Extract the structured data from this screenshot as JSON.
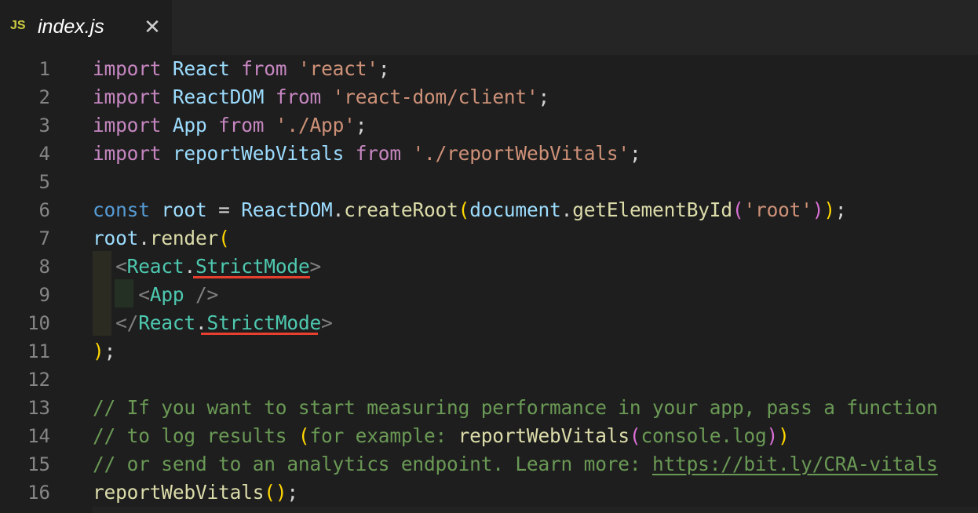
{
  "tab": {
    "icon_label": "JS",
    "title": "index.js",
    "close_glyph": "✕"
  },
  "lines": [
    {
      "n": "1",
      "tokens": [
        [
          "kw",
          "import"
        ],
        [
          "p",
          " "
        ],
        [
          "id",
          "React"
        ],
        [
          "p",
          " "
        ],
        [
          "kw",
          "from"
        ],
        [
          "p",
          " "
        ],
        [
          "str",
          "'react'"
        ],
        [
          "p",
          ";"
        ]
      ]
    },
    {
      "n": "2",
      "tokens": [
        [
          "kw",
          "import"
        ],
        [
          "p",
          " "
        ],
        [
          "id",
          "ReactDOM"
        ],
        [
          "p",
          " "
        ],
        [
          "kw",
          "from"
        ],
        [
          "p",
          " "
        ],
        [
          "str",
          "'react-dom/client'"
        ],
        [
          "p",
          ";"
        ]
      ]
    },
    {
      "n": "3",
      "tokens": [
        [
          "kw",
          "import"
        ],
        [
          "p",
          " "
        ],
        [
          "id",
          "App"
        ],
        [
          "p",
          " "
        ],
        [
          "kw",
          "from"
        ],
        [
          "p",
          " "
        ],
        [
          "str",
          "'./App'"
        ],
        [
          "p",
          ";"
        ]
      ]
    },
    {
      "n": "4",
      "tokens": [
        [
          "kw",
          "import"
        ],
        [
          "p",
          " "
        ],
        [
          "id",
          "reportWebVitals"
        ],
        [
          "p",
          " "
        ],
        [
          "kw",
          "from"
        ],
        [
          "p",
          " "
        ],
        [
          "str",
          "'./reportWebVitals'"
        ],
        [
          "p",
          ";"
        ]
      ]
    },
    {
      "n": "5",
      "tokens": []
    },
    {
      "n": "6",
      "tokens": [
        [
          "decl",
          "const"
        ],
        [
          "p",
          " "
        ],
        [
          "id",
          "root"
        ],
        [
          "p",
          " = "
        ],
        [
          "id",
          "ReactDOM"
        ],
        [
          "p",
          "."
        ],
        [
          "fn",
          "createRoot"
        ],
        [
          "br1",
          "("
        ],
        [
          "id",
          "document"
        ],
        [
          "p",
          "."
        ],
        [
          "fn",
          "getElementById"
        ],
        [
          "br2",
          "("
        ],
        [
          "str",
          "'root'"
        ],
        [
          "br2",
          ")"
        ],
        [
          "br1",
          ")"
        ],
        [
          "p",
          ";"
        ]
      ]
    },
    {
      "n": "7",
      "tokens": [
        [
          "id",
          "root"
        ],
        [
          "p",
          "."
        ],
        [
          "fn",
          "render"
        ],
        [
          "br1",
          "("
        ]
      ]
    },
    {
      "n": "8",
      "tokens": [
        [
          "p",
          "  "
        ],
        [
          "punct",
          "<"
        ],
        [
          "tag",
          "React"
        ],
        [
          "p",
          "."
        ],
        [
          "tag",
          "StrictMode"
        ],
        [
          "punct",
          ">"
        ]
      ]
    },
    {
      "n": "9",
      "tokens": [
        [
          "p",
          "    "
        ],
        [
          "punct",
          "<"
        ],
        [
          "tag",
          "App"
        ],
        [
          "p",
          " "
        ],
        [
          "punct",
          "/>"
        ]
      ]
    },
    {
      "n": "10",
      "tokens": [
        [
          "p",
          "  "
        ],
        [
          "punct",
          "</"
        ],
        [
          "tag",
          "React"
        ],
        [
          "p",
          "."
        ],
        [
          "tag",
          "StrictMode"
        ],
        [
          "punct",
          ">"
        ]
      ]
    },
    {
      "n": "11",
      "tokens": [
        [
          "br1",
          ")"
        ],
        [
          "p",
          ";"
        ]
      ]
    },
    {
      "n": "12",
      "tokens": []
    },
    {
      "n": "13",
      "tokens": [
        [
          "cm",
          "// If you want to start measuring performance in your app, pass a function"
        ]
      ]
    },
    {
      "n": "14",
      "tokens": [
        [
          "cm",
          "// to log results "
        ],
        [
          "br1",
          "("
        ],
        [
          "cm",
          "for example: "
        ],
        [
          "fn",
          "reportWebVitals"
        ],
        [
          "br2",
          "("
        ],
        [
          "cm",
          "console.log"
        ],
        [
          "br2",
          ")"
        ],
        [
          "br1",
          ")"
        ]
      ]
    },
    {
      "n": "15",
      "tokens": [
        [
          "cm",
          "// or send to an analytics endpoint. Learn more: "
        ],
        [
          "cmlink",
          "https://bit.ly/CRA-vitals"
        ]
      ]
    },
    {
      "n": "16",
      "tokens": [
        [
          "fn",
          "reportWebVitals"
        ],
        [
          "br1",
          "()"
        ],
        [
          "p",
          ";"
        ]
      ]
    }
  ],
  "colors": {
    "background": "#1e1e1e",
    "keyword": "#c586c0",
    "identifier": "#9cdcfe",
    "string": "#ce9178",
    "function": "#dcdcaa",
    "jsx_tag": "#4ec9b0",
    "comment": "#6a9955",
    "squiggle": "#e8402f"
  }
}
